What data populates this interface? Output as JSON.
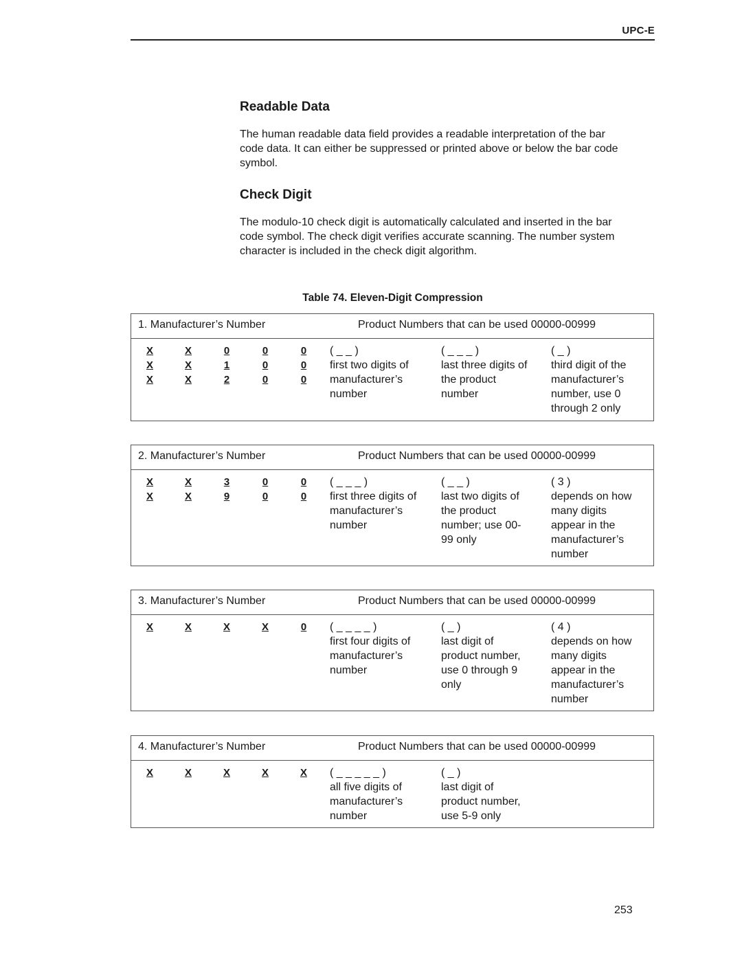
{
  "header": {
    "running_title": "UPC-E"
  },
  "sections": [
    {
      "title": "Readable Data",
      "paragraph_lines": [
        "The human readable data field provides a readable interpretation of the bar",
        "code data. It can either be suppressed or printed above or below the bar code",
        "symbol."
      ]
    },
    {
      "title": "Check Digit",
      "paragraph_lines": [
        "The modulo-10 check digit is automatically calculated and inserted in the bar",
        "code symbol. The check digit verifies accurate scanning. The number system",
        "character is included in the check digit algorithm."
      ]
    }
  ],
  "table": {
    "caption": "Table 74. Eleven-Digit Compression",
    "blocks": [
      {
        "header_left": "1. Manufacturer’s Number",
        "header_right": "Product Numbers that can be used 00000-00999",
        "digit_rows": [
          [
            "X",
            "X",
            "0",
            "0",
            "0"
          ],
          [
            "X",
            "X",
            "1",
            "0",
            "0"
          ],
          [
            "X",
            "X",
            "2",
            "0",
            "0"
          ]
        ],
        "descriptions": [
          {
            "pattern": "( _ _ )",
            "lines": [
              "first two digits of",
              "manufacturer’s",
              "number"
            ]
          },
          {
            "pattern": "( _ _ _ )",
            "lines": [
              "last three digits of",
              "the product",
              "number"
            ]
          },
          {
            "pattern": "( _ )",
            "lines": [
              "third digit of the",
              "manufacturer’s",
              "number, use 0",
              "through 2 only"
            ]
          }
        ]
      },
      {
        "header_left": "2. Manufacturer’s Number",
        "header_right": "Product Numbers that can be used 00000-00999",
        "digit_rows": [
          [
            "X",
            "X",
            "3",
            "0",
            "0"
          ],
          [
            "X",
            "X",
            "9",
            "0",
            "0"
          ]
        ],
        "descriptions": [
          {
            "pattern": "( _ _ _ )",
            "lines": [
              "first three digits of",
              "manufacturer’s",
              "number"
            ]
          },
          {
            "pattern": "( _ _ )",
            "lines": [
              "last two digits of",
              "the product",
              "number; use 00-",
              "99 only"
            ]
          },
          {
            "pattern": "( 3 )",
            "lines": [
              "depends on how",
              "many digits",
              "appear in the",
              "manufacturer’s",
              "number"
            ]
          }
        ]
      },
      {
        "header_left": "3. Manufacturer’s Number",
        "header_right": "Product Numbers that can be used 00000-00999",
        "digit_rows": [
          [
            "X",
            "X",
            "X",
            "X",
            "0"
          ]
        ],
        "descriptions": [
          {
            "pattern": "( _ _ _ _ )",
            "lines": [
              "first four digits of",
              "manufacturer’s",
              "number"
            ]
          },
          {
            "pattern": "( _ )",
            "lines": [
              "last digit of",
              "product number,",
              "use 0 through 9",
              "only"
            ]
          },
          {
            "pattern": "( 4 )",
            "lines": [
              "depends on how",
              "many digits",
              "appear in the",
              "manufacturer’s",
              "number"
            ]
          }
        ]
      },
      {
        "header_left": "4. Manufacturer’s Number",
        "header_right": "Product Numbers that can be used 00000-00999",
        "digit_rows": [
          [
            "X",
            "X",
            "X",
            "X",
            "X"
          ]
        ],
        "descriptions": [
          {
            "pattern": "( _ _ _ _ _ )",
            "lines": [
              "all five digits of",
              "manufacturer’s",
              "number"
            ]
          },
          {
            "pattern": "( _ )",
            "lines": [
              "last digit of",
              "product number,",
              "use 5-9 only"
            ]
          }
        ]
      }
    ]
  },
  "footer": {
    "page_number": "253"
  }
}
